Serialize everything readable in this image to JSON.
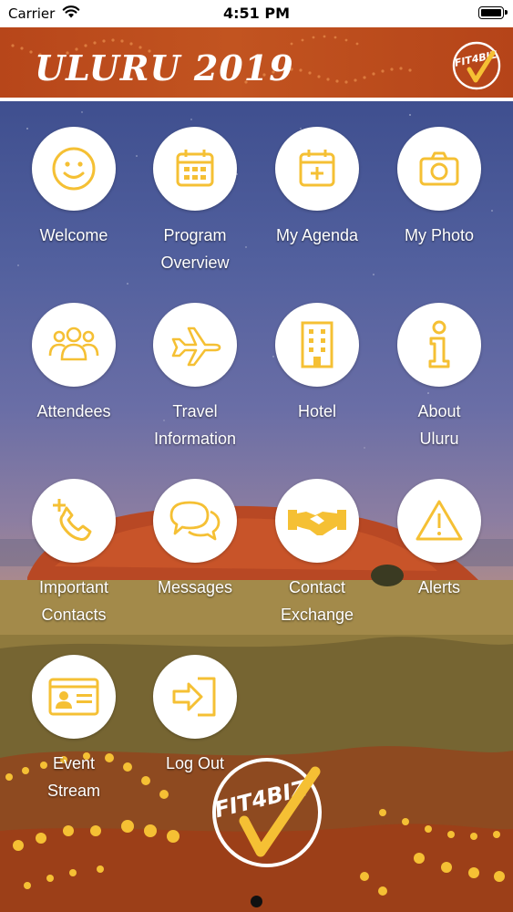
{
  "status_bar": {
    "carrier": "Carrier",
    "time": "4:51 PM"
  },
  "header": {
    "title": "ULURU 2019",
    "logo_text": "FIT4BIZ"
  },
  "colors": {
    "accent": "#f5c034",
    "header_bg": "#bd4c1d",
    "tile_bg": "#ffffff"
  },
  "tiles": [
    {
      "label": "Welcome",
      "icon": "smiley-icon"
    },
    {
      "label": "Program\nOverview",
      "icon": "calendar-icon"
    },
    {
      "label": "My Agenda",
      "icon": "calendar-add-icon"
    },
    {
      "label": "My Photo",
      "icon": "camera-icon"
    },
    {
      "label": "Attendees",
      "icon": "people-icon"
    },
    {
      "label": "Travel\nInformation",
      "icon": "airplane-icon"
    },
    {
      "label": "Hotel",
      "icon": "building-icon"
    },
    {
      "label": "About\nUluru",
      "icon": "info-icon"
    },
    {
      "label": "Important\nContacts",
      "icon": "phone-add-icon"
    },
    {
      "label": "Messages",
      "icon": "chat-icon"
    },
    {
      "label": "Contact\nExchange",
      "icon": "handshake-icon"
    },
    {
      "label": "Alerts",
      "icon": "warning-icon"
    },
    {
      "label": "Event\nStream",
      "icon": "id-card-icon"
    },
    {
      "label": "Log Out",
      "icon": "logout-icon"
    }
  ],
  "pager": {
    "pages": 1,
    "current": 1
  }
}
